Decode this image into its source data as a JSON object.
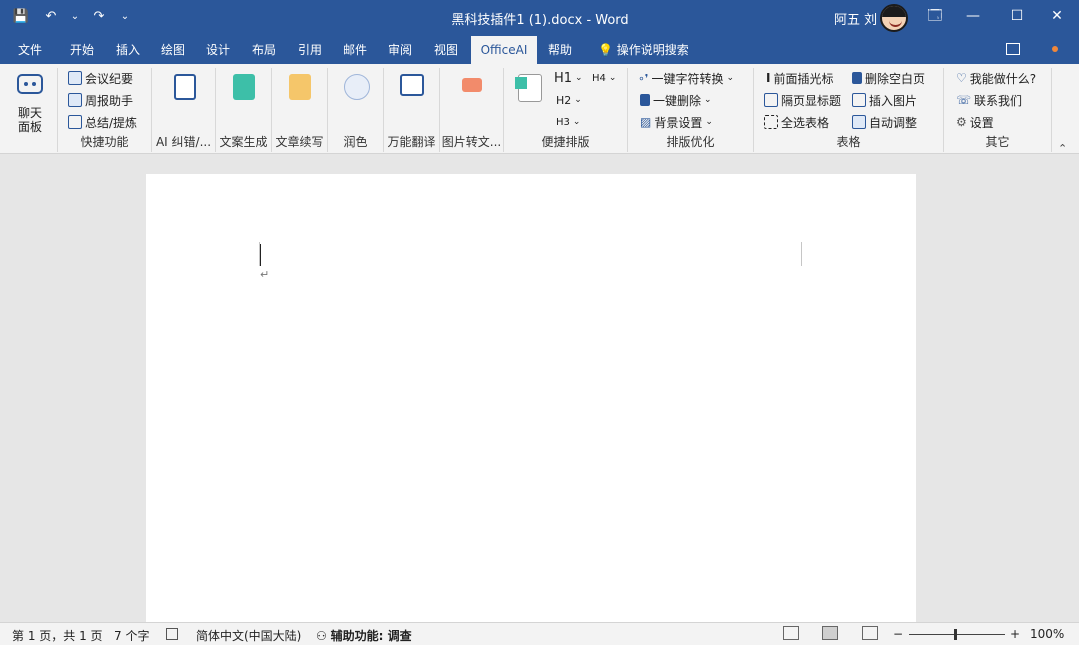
{
  "titlebar": {
    "qat": {
      "save": "💾",
      "undo": "↶",
      "undo_arrow": "⌄",
      "redo": "↷",
      "customize": "⌄"
    },
    "document_title": "黑科技插件1 (1).docx  -  Word",
    "user_name": "阿五 刘",
    "ribbon_display": "🗔",
    "minimize": "—",
    "maximize": "☐",
    "close": "✕"
  },
  "menu": {
    "tabs": [
      "文件",
      "开始",
      "插入",
      "绘图",
      "设计",
      "布局",
      "引用",
      "邮件",
      "审阅",
      "视图",
      "OfficeAI",
      "帮助"
    ],
    "active_tab": "OfficeAI",
    "tell_me": "操作说明搜索",
    "tell_me_icon": "💡"
  },
  "ribbon": {
    "chat_panel": "聊天\n面板",
    "quick": {
      "label": "快捷功能",
      "items": [
        "会议纪要",
        "周报助手",
        "总结/提炼"
      ]
    },
    "ai_correct": {
      "label": "AI 纠错/..."
    },
    "copy_gen": {
      "label": "文案生成"
    },
    "article_continue": {
      "label": "文章续写"
    },
    "polish": {
      "label": "润色"
    },
    "translate": {
      "label": "万能翻译"
    },
    "img_to_text": {
      "label": "图片转文..."
    },
    "layout": {
      "label": "便捷排版",
      "h1": "H1",
      "h4": "H4",
      "h2": "H2",
      "h3": "H3"
    },
    "format_opt": {
      "label": "排版优化",
      "items": [
        "一键字符转换",
        "一键删除",
        "背景设置"
      ]
    },
    "table": {
      "label": "表格",
      "items_left": [
        "前面插光标",
        "隔页显标题",
        "全选表格"
      ],
      "items_right": [
        "删除空白页",
        "插入图片",
        "自动调整"
      ]
    },
    "other": {
      "label": "其它",
      "items": [
        "我能做什么?",
        "联系我们",
        "设置"
      ]
    }
  },
  "document": {
    "paragraph_mark": "↵"
  },
  "statusbar": {
    "page": "第 1 页，共 1 页",
    "words": "7 个字",
    "language": "简体中文(中国大陆)",
    "accessibility": "辅助功能: 调查",
    "zoom_minus": "−",
    "zoom_plus": "+",
    "zoom": "100%"
  }
}
